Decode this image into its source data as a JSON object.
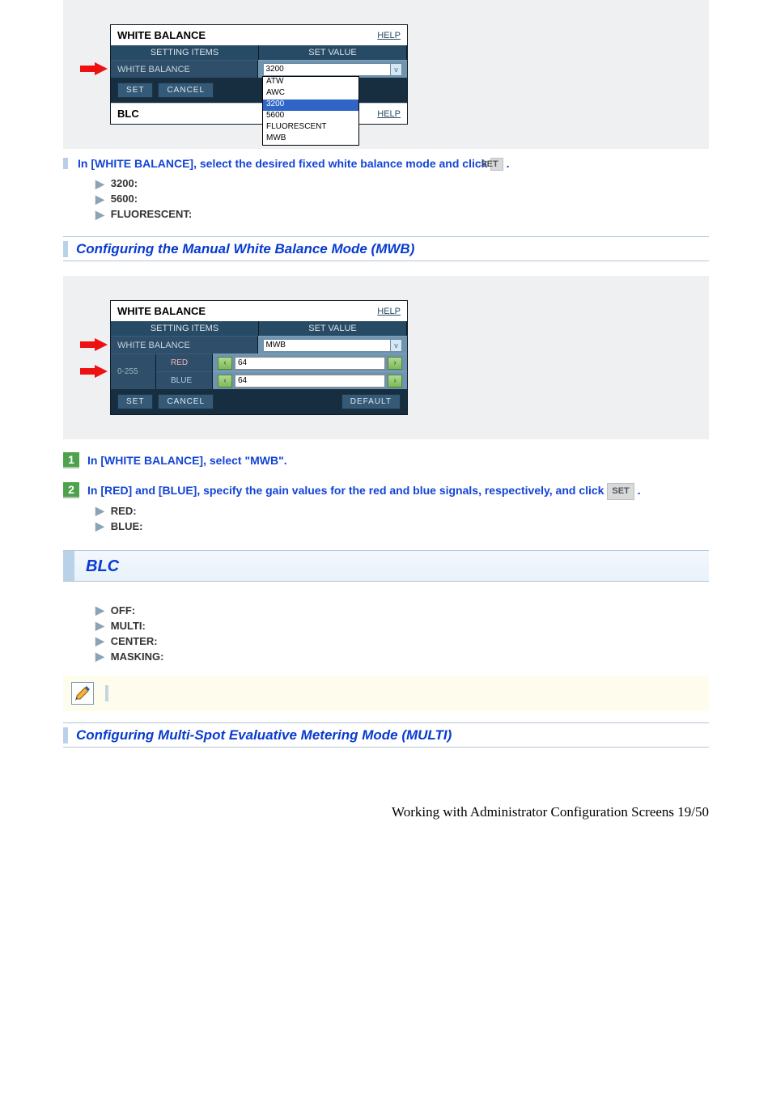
{
  "panel1": {
    "title": "WHITE BALANCE",
    "help": "HELP",
    "col1": "SETTING ITEMS",
    "col2": "SET VALUE",
    "row_label": "WHITE BALANCE",
    "selected": "3200",
    "options": [
      "ATW",
      "AWC",
      "3200",
      "5600",
      "FLUORESCENT",
      "MWB"
    ],
    "set": "SET",
    "cancel": "CANCEL",
    "blc": "BLC",
    "blc_help": "HELP"
  },
  "instr1": {
    "text_a": "In [WHITE BALANCE], select the desired fixed white balance mode and click ",
    "set": "SET",
    "text_b": " ."
  },
  "list1": [
    "3200:",
    "5600:",
    "FLUORESCENT:"
  ],
  "sec1": "Configuring the Manual White Balance Mode (MWB)",
  "panel2": {
    "title": "WHITE BALANCE",
    "help": "HELP",
    "col1": "SETTING ITEMS",
    "col2": "SET VALUE",
    "row_label": "WHITE BALANCE",
    "selected": "MWB",
    "range": "0-255",
    "red_lbl": "RED",
    "blue_lbl": "BLUE",
    "red_val": "64",
    "blue_val": "64",
    "set": "SET",
    "cancel": "CANCEL",
    "default": "DEFAULT"
  },
  "step1": "In [WHITE BALANCE], select \"MWB\".",
  "step2_a": "In [RED] and [BLUE], specify the gain values for the red and blue signals, respectively, and click ",
  "step2_set": "SET",
  "step2_b": " .",
  "list2": [
    "RED:",
    "BLUE:"
  ],
  "big_sec": "BLC",
  "list3": [
    "OFF:",
    "MULTI:",
    "CENTER:",
    "MASKING:"
  ],
  "sec2": "Configuring Multi-Spot Evaluative Metering Mode (MULTI)",
  "footer": "Working with Administrator Configuration Screens 19/50"
}
